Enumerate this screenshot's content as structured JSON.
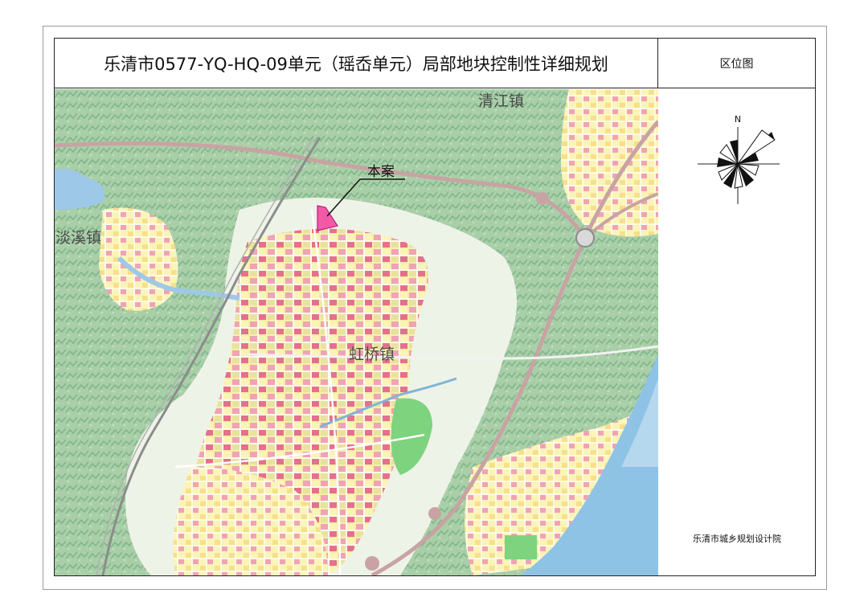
{
  "title": "乐清市0577-YQ-HQ-09单元（瑶岙单元）局部地块控制性详细规划",
  "side_header": "区位图",
  "credit": "乐清市城乡规划设计院",
  "compass": {
    "north_label": "N",
    "icon": "compass-rose-icon"
  },
  "map": {
    "place_labels": {
      "qingjiang": "清江镇",
      "danxi": "淡溪镇",
      "hongqiao": "虹桥镇"
    },
    "site_label": "本案",
    "colors": {
      "mountain": "#a9cfa8",
      "mountain_dark": "#7fb48a",
      "urban_yellow": "#f6f0a6",
      "residential_pink": "#f0a3b5",
      "commercial_red": "#e5708e",
      "green_space": "#7ed37f",
      "water": "#9ec8e8",
      "sea": "#8ec3e6",
      "road": "#ffffff",
      "expressway": "#c9a3a3",
      "site": "#f25aa8"
    }
  }
}
